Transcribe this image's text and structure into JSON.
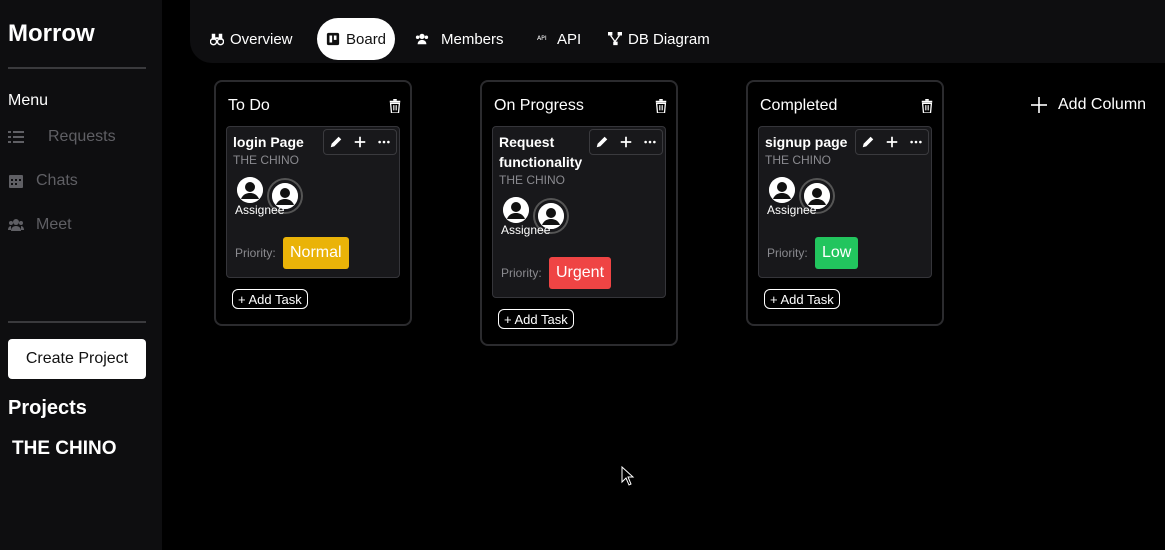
{
  "sidebar": {
    "brand": "Morrow",
    "menu_label": "Menu",
    "nav": [
      {
        "label": "Requests",
        "icon": "list-icon"
      },
      {
        "label": "Chats",
        "icon": "calendar-icon"
      },
      {
        "label": "Meet",
        "icon": "users-icon"
      }
    ],
    "create_project": "Create Project",
    "projects_title": "Projects",
    "projects": [
      "THE CHINO"
    ]
  },
  "tabs": [
    {
      "label": "Overview",
      "icon": "binoculars-icon"
    },
    {
      "label": "Board",
      "icon": "board-icon",
      "active": true
    },
    {
      "label": "Members",
      "icon": "users-icon"
    },
    {
      "label": "API",
      "icon": "api-icon"
    },
    {
      "label": "DB Diagram",
      "icon": "diagram-icon"
    }
  ],
  "columns": [
    {
      "title": "To Do",
      "card": {
        "title": "login Page",
        "project": "THE CHINO",
        "assignee_label": "Assignee",
        "priority_label": "Priority:",
        "priority": "Normal",
        "priority_color": "#eab308"
      },
      "add_task": "+ Add Task"
    },
    {
      "title": "On Progress",
      "card": {
        "title": "Request functionality",
        "project": "THE CHINO",
        "assignee_label": "Assignee",
        "priority_label": "Priority:",
        "priority": "Urgent",
        "priority_color": "#ef4444"
      },
      "add_task": "+ Add Task"
    },
    {
      "title": "Completed",
      "card": {
        "title": "signup page",
        "project": "THE CHINO",
        "assignee_label": "Assignee",
        "priority_label": "Priority:",
        "priority": "Low",
        "priority_color": "#22c55e"
      },
      "add_task": "+ Add Task"
    }
  ],
  "add_column": "Add Column"
}
